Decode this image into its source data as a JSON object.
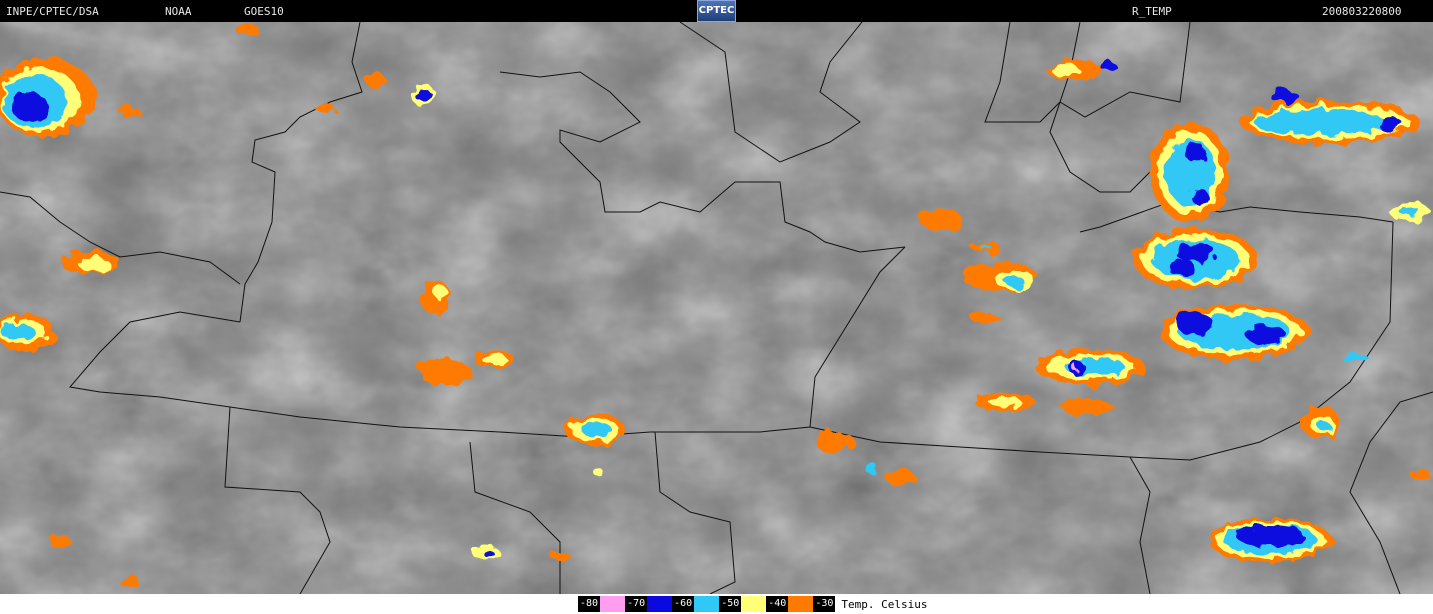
{
  "header": {
    "source": "INPE/CPTEC/DSA",
    "agency": "NOAA",
    "satellite": "GOES10",
    "logo_text": "CPTEC",
    "product": "R_TEMP",
    "datetime": "200803220800"
  },
  "legend": {
    "items": [
      {
        "label": "-80",
        "color": "#ff9ef0"
      },
      {
        "label": "-70",
        "color": "#0a0ae0"
      },
      {
        "label": "-60",
        "color": "#31c8f5"
      },
      {
        "label": "-50",
        "color": "#ffff78"
      },
      {
        "label": "-40",
        "color": "#ff7a00"
      },
      {
        "label": "-30",
        "color": ""
      }
    ],
    "unit": "Temp. Celsius"
  }
}
